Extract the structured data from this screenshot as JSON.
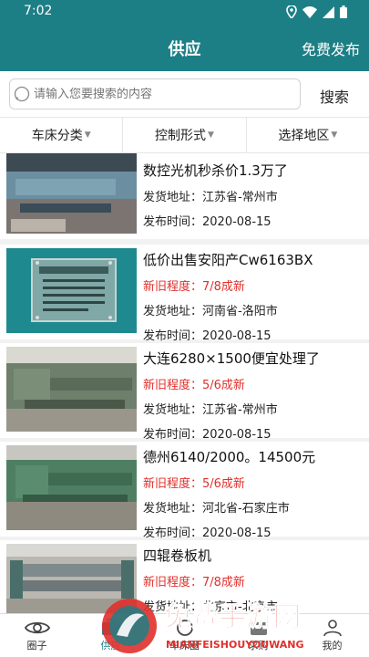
{
  "status": {
    "time": "7:02"
  },
  "header": {
    "title": "供应",
    "publish_label": "免费发布"
  },
  "search": {
    "placeholder": "请输入您要搜索的内容",
    "button_label": "搜索"
  },
  "filters": [
    {
      "label": "车床分类"
    },
    {
      "label": "控制形式"
    },
    {
      "label": "选择地区"
    }
  ],
  "listings": [
    {
      "title": "数控光机秒杀价1.3万了",
      "condition": "",
      "address": "发货地址：江苏省-常州市",
      "time": "发布时间：2020-08-15"
    },
    {
      "title": "低价出售安阳产Cw6163BX",
      "condition": "新旧程度：7/8成新",
      "address": "发货地址：河南省-洛阳市",
      "time": "发布时间：2020-08-15"
    },
    {
      "title": "大连6280×1500便宜处理了",
      "condition": "新旧程度：5/6成新",
      "address": "发货地址：江苏省-常州市",
      "time": "发布时间：2020-08-15"
    },
    {
      "title": "德州6140/2000。14500元",
      "condition": "新旧程度：5/6成新",
      "address": "发货地址：河北省-石家庄市",
      "time": "发布时间：2020-08-15"
    },
    {
      "title": "四辊卷板机",
      "condition": "新旧程度：7/8成新",
      "address": "发货地址：北京市-北京市",
      "time": ""
    }
  ],
  "nav": [
    {
      "label": "圈子",
      "icon": "eye-icon"
    },
    {
      "label": "供应",
      "icon": "supply-icon"
    },
    {
      "label": "车床圈",
      "icon": "lathe-circle-icon"
    },
    {
      "label": "求购",
      "icon": "buy-icon"
    },
    {
      "label": "我的",
      "icon": "person-icon"
    }
  ],
  "watermark": {
    "brand": "免费手游网",
    "domain": "MIANFEISHOUYOUWANG"
  },
  "colors": {
    "primary": "#1d7f86",
    "condition": "#e0302b",
    "watermark": "#e0302b"
  }
}
